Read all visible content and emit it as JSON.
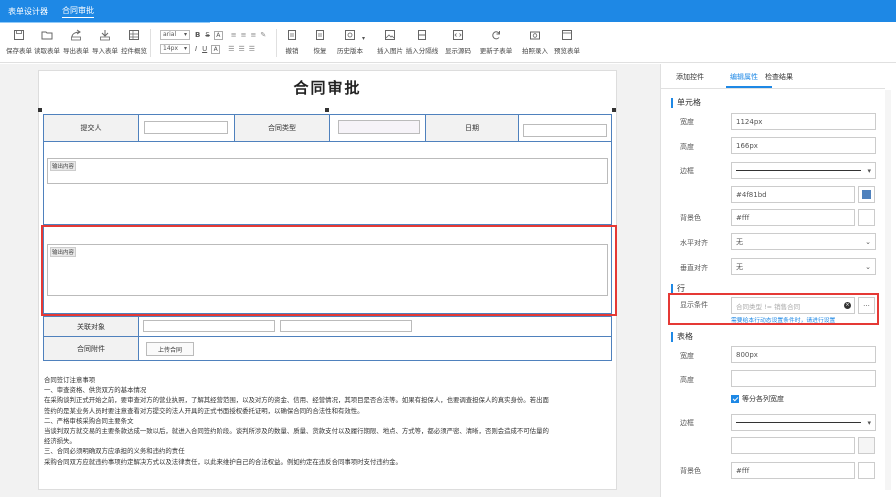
{
  "app": {
    "tabs": [
      "表单设计器",
      "合同审批"
    ],
    "accent": "#1e88e5",
    "highlight": "#e53935"
  },
  "toolbar": {
    "buttons": [
      {
        "label": "保存表单",
        "icon": "save-icon"
      },
      {
        "label": "读取表单",
        "icon": "folder-open-icon"
      },
      {
        "label": "导出表单",
        "icon": "export-icon"
      },
      {
        "label": "导入表单",
        "icon": "import-icon"
      },
      {
        "label": "控件概览",
        "icon": "grid-icon"
      },
      {
        "label": "撤销",
        "icon": "undo-icon"
      },
      {
        "label": "恢复",
        "icon": "redo-icon"
      },
      {
        "label": "历史版本",
        "icon": "history-icon"
      },
      {
        "label": "插入图片",
        "icon": "image-icon"
      },
      {
        "label": "插入分隔线",
        "icon": "divider-icon"
      },
      {
        "label": "显示源码",
        "icon": "code-icon"
      },
      {
        "label": "更新子表单",
        "icon": "refresh-icon"
      },
      {
        "label": "拍照录入",
        "icon": "camera-icon"
      },
      {
        "label": "预览表单",
        "icon": "preview-icon"
      }
    ],
    "font_name": "arial",
    "font_size": "14px",
    "format": {
      "bold": "B",
      "italic": "I",
      "strike": "S",
      "underline": "U",
      "color": "A"
    }
  },
  "form": {
    "title": "合同审批",
    "row1": {
      "submitter_label": "提交人",
      "contract_type_label": "合同类型",
      "date_label": "日期"
    },
    "textarea1_placeholder": "输出内容",
    "textarea2_placeholder": "输出内容",
    "related_label": "关联对象",
    "attachment_label": "合同附件",
    "upload_button": "上传合同",
    "notes": [
      "合同签订注意事项",
      "一、审查资格、供货双方的基本情况",
      "在采购谈判正式开始之前，要审查对方的营业执照，了解其经营范围，以及对方的资金、信用、经营情况，其项目是否合法等。如果有担保人，也要调查担保人的真实身份。若出面",
      "签约的是某业务人员时要注意查看对方提交的法人开具的正式书面授权委托证明，以确保合同的合法性和有效性。",
      "二、严格审核采购合同主要条文",
      "当谈判双方就交易的主要条款达成一致以后，就进入合同签约阶段。谈判所涉及的数量、质量、货款支付以及履行期限、地点、方式等，都必须严密、清晰，否则会造成不可估量的",
      "经济损失。",
      "三、合同必须明确双方应承担的义务和违约的责任",
      "采购合同双方应就违约事项约定解决方式以及法律责任，以此来维护自己的合法权益。例如约定在违反合同事项时支付违约金。"
    ]
  },
  "panel": {
    "tabs": [
      "添加控件",
      "编辑属性",
      "检查结果"
    ],
    "cell_section": "单元格",
    "width_label": "宽度",
    "width_value": "1124px",
    "height_label": "高度",
    "height_value": "166px",
    "border_label": "边框",
    "border_color": "#4f81bd",
    "bg_label": "背景色",
    "bg_value": "#fff",
    "halign_label": "水平对齐",
    "halign_value": "无",
    "valign_label": "垂直对齐",
    "valign_value": "无",
    "row_section": "行",
    "condition_label": "显示条件",
    "condition_value": "合同类型 != 销售合同",
    "condition_hint": "需要给本行动态设置条件时，请进行设置",
    "table_section": "表格",
    "tbl_width_label": "宽度",
    "tbl_width_value": "800px",
    "tbl_height_label": "高度",
    "tbl_height_value": "",
    "equal_cols_label": "等分各列宽度",
    "tbl_border_label": "边框",
    "tbl_bg_label": "背景色",
    "tbl_bg_value": "#fff",
    "more_button": "..."
  }
}
